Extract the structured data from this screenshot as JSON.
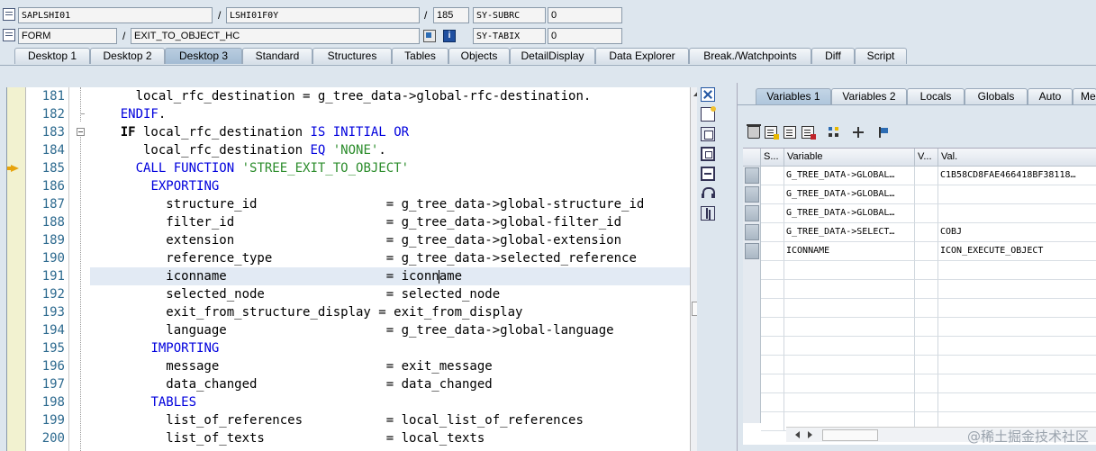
{
  "header": {
    "program": "SAPLSHI01",
    "include": "LSHI01F0Y",
    "line": "185",
    "sysfield1_name": "SY-SUBRC",
    "sysfield1_value": "0",
    "event_type": "FORM",
    "event_name": "EXIT_TO_OBJECT_HC",
    "sysfield2_name": "SY-TABIX",
    "sysfield2_value": "0",
    "separator_slash": "/"
  },
  "tabs": [
    {
      "label": "Desktop 1",
      "active": false
    },
    {
      "label": "Desktop 2",
      "active": false
    },
    {
      "label": "Desktop 3",
      "active": true
    },
    {
      "label": "Standard",
      "active": false
    },
    {
      "label": "Structures",
      "active": false
    },
    {
      "label": "Tables",
      "active": false
    },
    {
      "label": "Objects",
      "active": false
    },
    {
      "label": "DetailDisplay",
      "active": false
    },
    {
      "label": "Data Explorer",
      "active": false
    },
    {
      "label": "Break./Watchpoints",
      "active": false
    },
    {
      "label": "Diff",
      "active": false
    },
    {
      "label": "Script",
      "active": false
    }
  ],
  "source": {
    "current_line": "185",
    "lines": [
      {
        "num": "181",
        "text": "      local_rfc_destination = g_tree_data->global-rfc-destination."
      },
      {
        "num": "182",
        "text": "    ENDIF."
      },
      {
        "num": "183",
        "text": "    IF local_rfc_destination IS INITIAL OR"
      },
      {
        "num": "184",
        "text": "       local_rfc_destination EQ 'NONE'."
      },
      {
        "num": "185",
        "text": "      CALL FUNCTION 'STREE_EXIT_TO_OBJECT'"
      },
      {
        "num": "186",
        "text": "        EXPORTING"
      },
      {
        "num": "187",
        "text": "          structure_id                 = g_tree_data->global-structure_id"
      },
      {
        "num": "188",
        "text": "          filter_id                    = g_tree_data->global-filter_id"
      },
      {
        "num": "189",
        "text": "          extension                    = g_tree_data->global-extension"
      },
      {
        "num": "190",
        "text": "          reference_type               = g_tree_data->selected_reference"
      },
      {
        "num": "191",
        "text": "          iconname                     = iconname"
      },
      {
        "num": "192",
        "text": "          selected_node                = selected_node"
      },
      {
        "num": "193",
        "text": "          exit_from_structure_display = exit_from_display"
      },
      {
        "num": "194",
        "text": "          language                     = g_tree_data->global-language"
      },
      {
        "num": "195",
        "text": "        IMPORTING"
      },
      {
        "num": "196",
        "text": "          message                      = exit_message"
      },
      {
        "num": "197",
        "text": "          data_changed                 = data_changed"
      },
      {
        "num": "198",
        "text": "        TABLES"
      },
      {
        "num": "199",
        "text": "          list_of_references           = local_list_of_references"
      },
      {
        "num": "200",
        "text": "          list_of_texts                = local_texts"
      }
    ]
  },
  "variables_pane": {
    "tabs": [
      {
        "label": "Variables 1",
        "active": true
      },
      {
        "label": "Variables 2",
        "active": false
      },
      {
        "label": "Locals",
        "active": false
      },
      {
        "label": "Globals",
        "active": false
      },
      {
        "label": "Auto",
        "active": false
      },
      {
        "label": "Me",
        "active": false
      }
    ],
    "columns": {
      "s": "S...",
      "variable": "Variable",
      "v": "V...",
      "val": "Val."
    },
    "rows": [
      {
        "variable": "G_TREE_DATA->GLOBAL…",
        "value": "C1B58CD8FAE466418BF38118…"
      },
      {
        "variable": "G_TREE_DATA->GLOBAL…",
        "value": ""
      },
      {
        "variable": "G_TREE_DATA->GLOBAL…",
        "value": ""
      },
      {
        "variable": "G_TREE_DATA->SELECT…",
        "value": "COBJ"
      },
      {
        "variable": "ICONNAME",
        "value": "ICON_EXECUTE_OBJECT"
      },
      {
        "variable": "",
        "value": ""
      },
      {
        "variable": "",
        "value": ""
      },
      {
        "variable": "",
        "value": ""
      },
      {
        "variable": "",
        "value": ""
      },
      {
        "variable": "",
        "value": ""
      },
      {
        "variable": "",
        "value": ""
      },
      {
        "variable": "",
        "value": ""
      },
      {
        "variable": "",
        "value": ""
      },
      {
        "variable": "",
        "value": ""
      }
    ]
  },
  "watermark": "@稀土掘金技术社区",
  "colors": {
    "keyword": "#0000dd",
    "string": "#2b8c2b",
    "line_number": "#2d6a8f",
    "exec_arrow": "#e7a40d",
    "current_line_bg": "#e2eaf4"
  }
}
